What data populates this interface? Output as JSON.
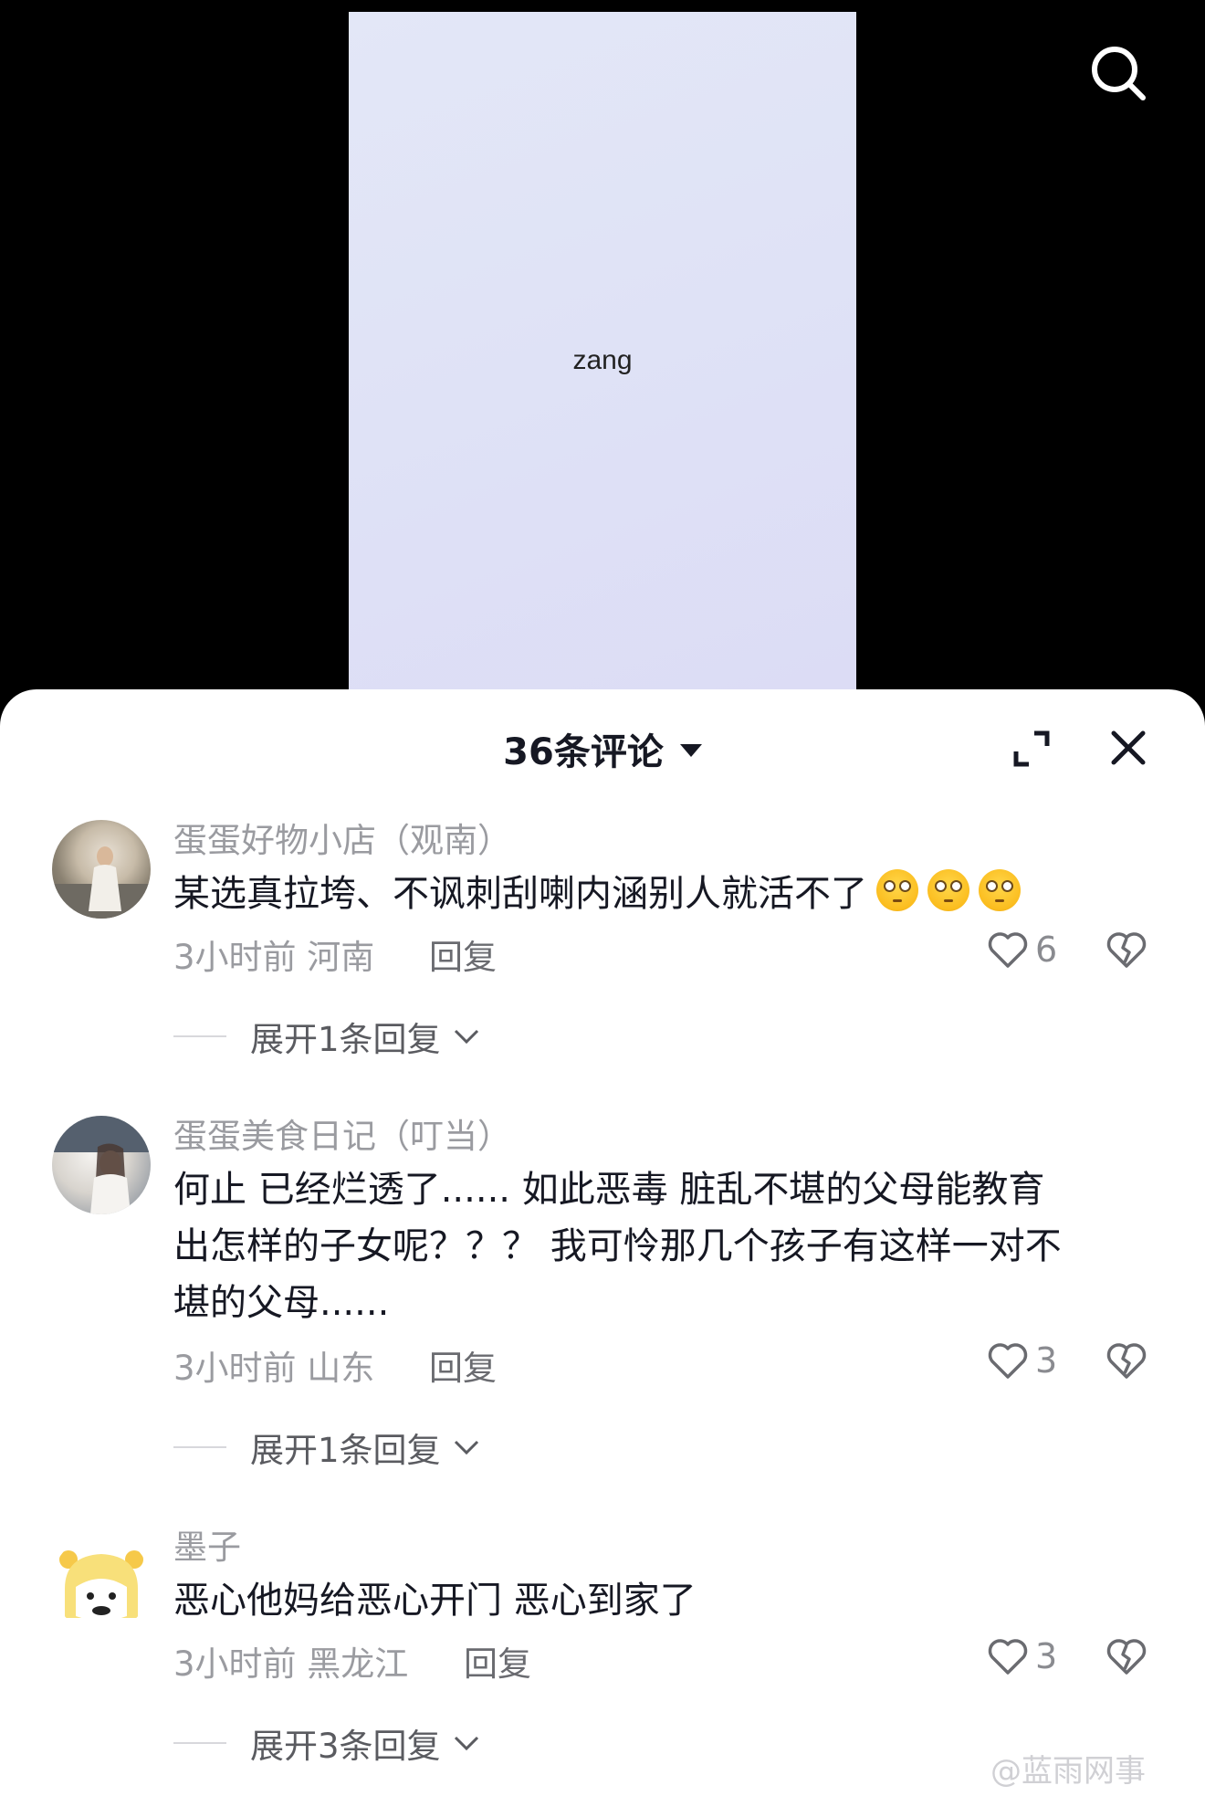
{
  "video": {
    "label": "zang"
  },
  "sheet": {
    "title": "36条评论"
  },
  "comments": [
    {
      "user": "蛋蛋好物小店（观南）",
      "text": "某选真拉垮、不讽刺刮喇内涵别人就活不了",
      "emoji_count": 3,
      "time": "3小时前 河南",
      "reply_label": "回复",
      "likes": "6",
      "expand_label": "展开1条回复"
    },
    {
      "user": "蛋蛋美食日记（叮当）",
      "text_lines": [
        "何止  已经烂透了...... 如此恶毒 脏乱不堪的父母能教育",
        "出怎样的子女呢？？？  我可怜那几个孩子有这样一对不",
        "堪的父母......"
      ],
      "time": "3小时前 山东",
      "reply_label": "回复",
      "likes": "3",
      "expand_label": "展开1条回复"
    },
    {
      "user": "墨子",
      "text": "恶心他妈给恶心开门 恶心到家了",
      "time": "3小时前 黑龙江",
      "reply_label": "回复",
      "likes": "3",
      "expand_label": "展开3条回复"
    }
  ],
  "watermark": "@蓝雨网事",
  "icons": {
    "search": "search-icon",
    "expand": "expand-icon",
    "close": "close-icon",
    "heart": "heart-icon",
    "dislike": "broken-heart-icon",
    "chevron": "chevron-down-icon",
    "emoji": "eye-roll-emoji-icon"
  },
  "colors": {
    "primary_text": "#161823",
    "secondary_text": "#9a9ba0",
    "sheet_bg": "#ffffff",
    "backdrop": "#000000"
  }
}
